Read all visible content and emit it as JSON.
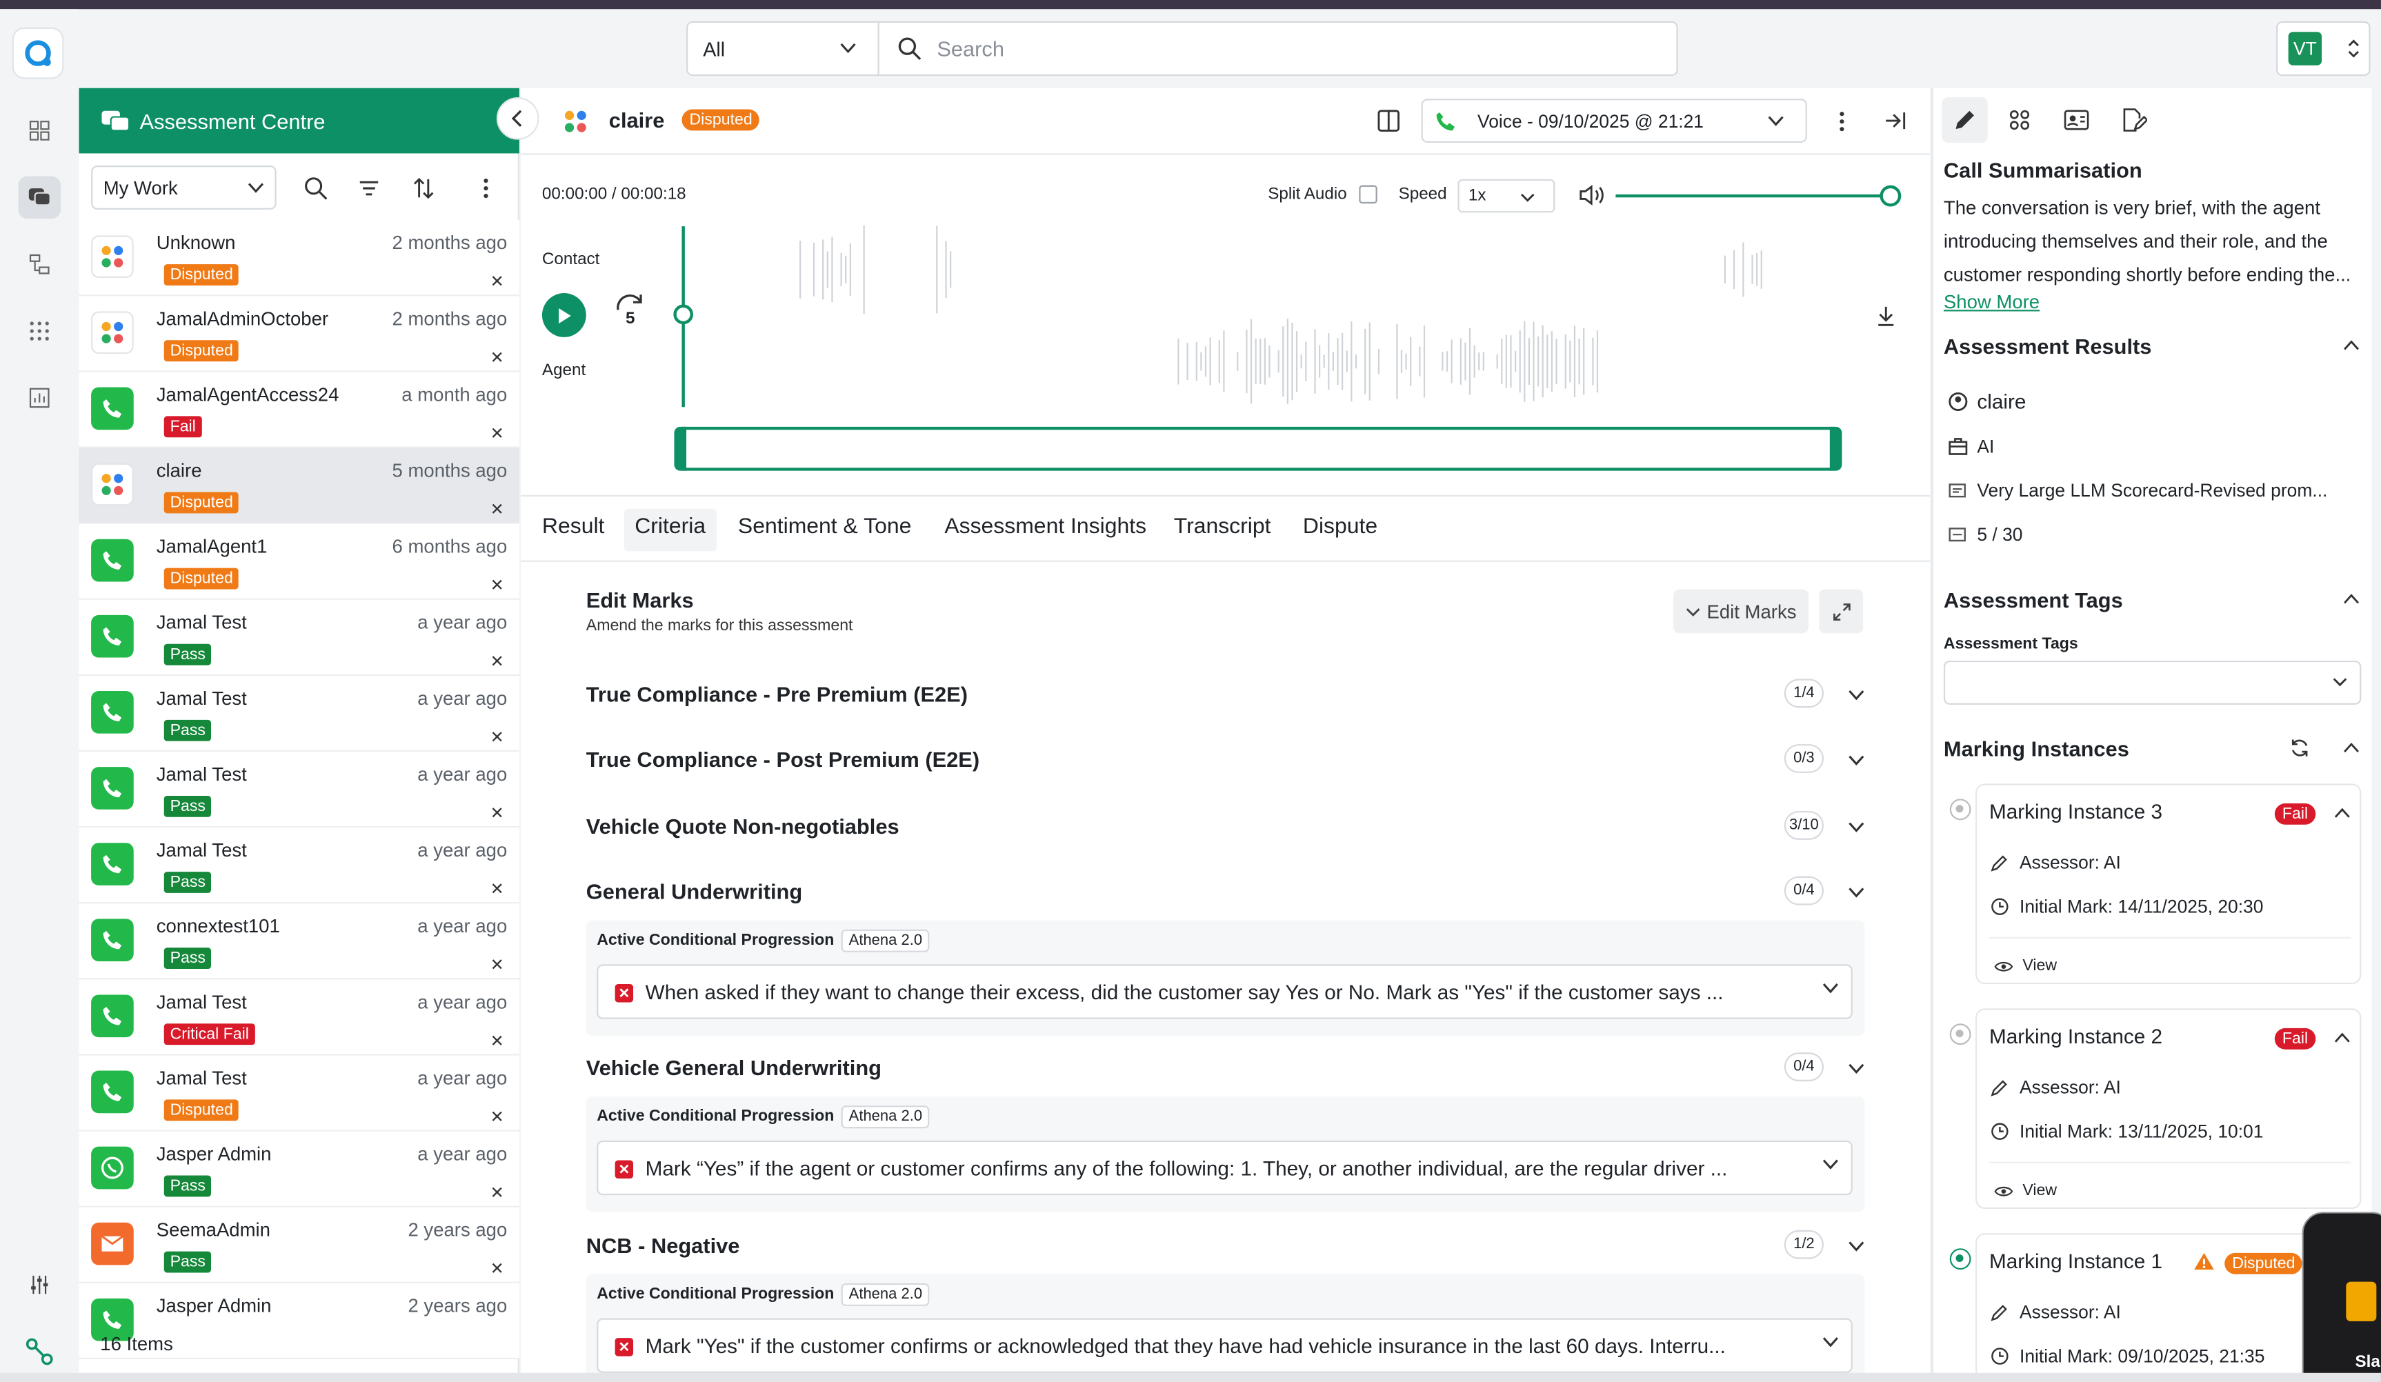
{
  "header": {
    "filter_value": "All",
    "search_placeholder": "Search",
    "user_initials": "VT"
  },
  "list": {
    "title": "Assessment Centre",
    "work_filter": "My Work",
    "items": [
      {
        "name": "Unknown",
        "time": "2 months ago",
        "badge": "Disputed",
        "icon": "grid-icon"
      },
      {
        "name": "JamalAdminOctober",
        "time": "2 months ago",
        "badge": "Disputed",
        "icon": "grid-icon"
      },
      {
        "name": "JamalAgentAccess24",
        "time": "a month ago",
        "badge": "Fail",
        "icon": "phone-icon"
      },
      {
        "name": "claire",
        "time": "5 months ago",
        "badge": "Disputed",
        "icon": "grid-icon"
      },
      {
        "name": "JamalAgent1",
        "time": "6 months ago",
        "badge": "Disputed",
        "icon": "phone-icon"
      },
      {
        "name": "Jamal Test",
        "time": "a year ago",
        "badge": "Pass",
        "icon": "phone-icon"
      },
      {
        "name": "Jamal Test",
        "time": "a year ago",
        "badge": "Pass",
        "icon": "phone-icon"
      },
      {
        "name": "Jamal Test",
        "time": "a year ago",
        "badge": "Pass",
        "icon": "phone-icon"
      },
      {
        "name": "Jamal Test",
        "time": "a year ago",
        "badge": "Pass",
        "icon": "phone-icon"
      },
      {
        "name": "connextest101",
        "time": "a year ago",
        "badge": "Pass",
        "icon": "phone-icon"
      },
      {
        "name": "Jamal Test",
        "time": "a year ago",
        "badge": "Critical Fail",
        "icon": "phone-icon"
      },
      {
        "name": "Jamal Test",
        "time": "a year ago",
        "badge": "Disputed",
        "icon": "phone-icon"
      },
      {
        "name": "Jasper Admin",
        "time": "a year ago",
        "badge": "Pass",
        "icon": "whatsapp-icon"
      },
      {
        "name": "SeemaAdmin",
        "time": "2 years ago",
        "badge": "Pass",
        "icon": "mail-icon"
      },
      {
        "name": "Jasper Admin",
        "time": "2 years ago",
        "badge": "",
        "icon": "phone-icon"
      }
    ],
    "count": "16 Items"
  },
  "main": {
    "title": "claire",
    "status": "Disputed",
    "voice_label": "Voice - 09/10/2025 @ 21:21",
    "time": "00:00:00 / 00:00:18",
    "split_audio": "Split Audio",
    "speed_label": "Speed",
    "speed_value": "1x",
    "contact_label": "Contact",
    "agent_label": "Agent",
    "skip_number": "5",
    "tabs": [
      "Result",
      "Criteria",
      "Sentiment & Tone",
      "Assessment Insights",
      "Transcript",
      "Dispute"
    ],
    "edit_title": "Edit Marks",
    "edit_sub": "Amend the marks for this assessment",
    "edit_button": "Edit Marks",
    "sections": [
      {
        "title": "True Compliance - Pre Premium (E2E)",
        "score": "1/4"
      },
      {
        "title": "True Compliance - Post Premium (E2E)",
        "score": "0/3"
      },
      {
        "title": "Vehicle Quote Non-negotiables",
        "score": "3/10"
      },
      {
        "title": "General Underwriting",
        "score": "0/4"
      },
      {
        "title": "Vehicle General Underwriting",
        "score": "0/4"
      },
      {
        "title": "NCB - Negative",
        "score": "1/2"
      }
    ],
    "cond_label": "Active Conditional Progression",
    "athena": "Athena 2.0",
    "criteria": [
      "When asked if they want to change their excess, did the customer say Yes or No. Mark as \"Yes\" if the customer says ...",
      "Mark “Yes” if the agent or customer confirms any of the following: 1. They, or another individual, are the regular driver ...",
      "Mark \"Yes\" if the customer confirms or acknowledged that they have had vehicle insurance in the last 60 days. Interru..."
    ]
  },
  "right": {
    "summary_title": "Call Summarisation",
    "summary_lines": [
      "The conversation is very brief, with the agent",
      "introducing themselves and their role, and the",
      "customer responding shortly before ending the..."
    ],
    "show_more": "Show More",
    "results_title": "Assessment Results",
    "results": {
      "agent": "claire",
      "assessor": "AI",
      "scorecard": "Very Large LLM Scorecard-Revised prom...",
      "score": "5 / 30"
    },
    "tags_title": "Assessment Tags",
    "tags_label": "Assessment Tags",
    "marking_title": "Marking Instances",
    "instances": [
      {
        "title": "Marking Instance 3",
        "badge": "Fail",
        "assessor": "Assessor: AI",
        "initial": "Initial Mark: 14/11/2025, 20:30",
        "view": "View"
      },
      {
        "title": "Marking Instance 2",
        "badge": "Fail",
        "assessor": "Assessor: AI",
        "initial": "Initial Mark: 13/11/2025, 10:01",
        "view": "View"
      },
      {
        "title": "Marking Instance 1",
        "badge": "Disputed",
        "assessor": "Assessor: AI",
        "initial": "Initial Mark: 09/10/2025, 21:35"
      }
    ],
    "corner_label": "Sla"
  }
}
